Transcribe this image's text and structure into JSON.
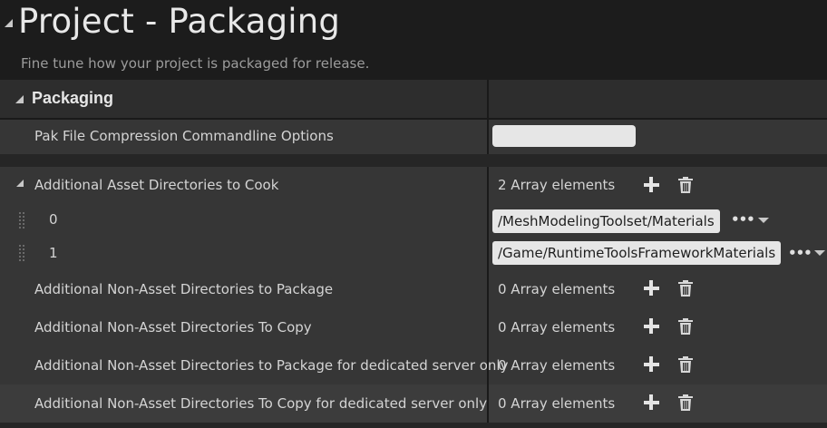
{
  "header": {
    "title": "Project - Packaging",
    "subtitle": "Fine tune how your project is packaged for release."
  },
  "section": {
    "title": "Packaging"
  },
  "properties": {
    "pak_compression": {
      "label": "Pak File Compression Commandline Options",
      "value": ""
    },
    "asset_dirs_cook": {
      "label": "Additional Asset Directories to Cook",
      "count": "2 Array elements",
      "elements": [
        {
          "index": "0",
          "value": "/MeshModelingToolset/Materials"
        },
        {
          "index": "1",
          "value": "/Game/RuntimeToolsFrameworkMaterials"
        }
      ]
    },
    "non_asset_package": {
      "label": "Additional Non-Asset Directories to Package",
      "count": "0 Array elements"
    },
    "non_asset_copy": {
      "label": "Additional Non-Asset Directories To Copy",
      "count": "0 Array elements"
    },
    "non_asset_package_server": {
      "label": "Additional Non-Asset Directories to Package for dedicated server only",
      "count": "0 Array elements"
    },
    "non_asset_copy_server": {
      "label": "Additional Non-Asset Directories To Copy for dedicated server only",
      "count": "0 Array elements"
    }
  },
  "icons": {
    "add": "plus-icon",
    "delete": "trash-icon",
    "more": "ellipsis-icon",
    "dropdown": "chevron-down-icon",
    "drag": "drag-handle-icon"
  }
}
